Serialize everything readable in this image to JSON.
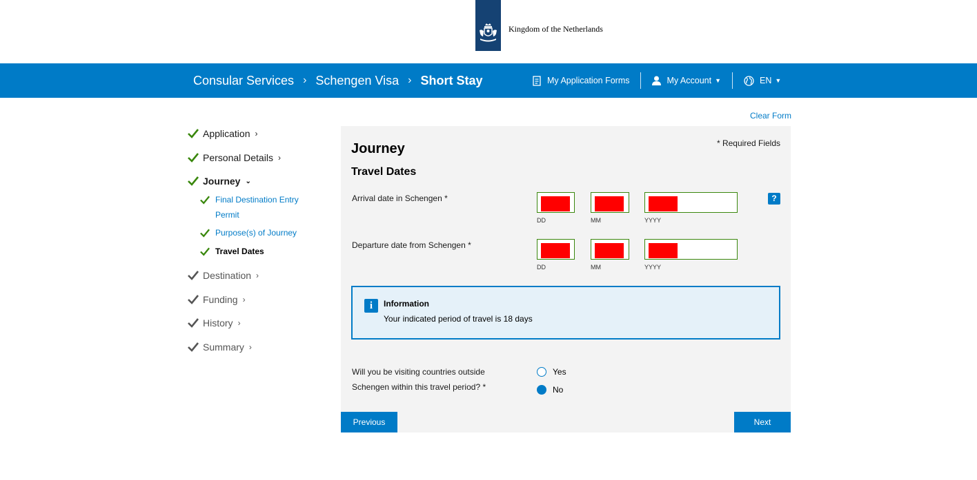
{
  "header": {
    "org_name": "Kingdom of the Netherlands"
  },
  "navbar": {
    "breadcrumbs": [
      "Consular Services",
      "Schengen Visa",
      "Short Stay"
    ],
    "application_forms": "My Application Forms",
    "account": "My Account",
    "language": "EN"
  },
  "clear_form": "Clear Form",
  "sidebar": {
    "steps": [
      {
        "label": "Application",
        "state": "done"
      },
      {
        "label": "Personal Details",
        "state": "done"
      },
      {
        "label": "Journey",
        "state": "active"
      },
      {
        "label": "Destination",
        "state": "todo"
      },
      {
        "label": "Funding",
        "state": "todo"
      },
      {
        "label": "History",
        "state": "todo"
      },
      {
        "label": "Summary",
        "state": "todo"
      }
    ],
    "journey_substeps": [
      {
        "label_line1": "Final Destination Entry",
        "label_line2": "Permit"
      },
      {
        "label_line1": "Purpose(s) of Journey"
      },
      {
        "label_line1": "Travel Dates"
      }
    ]
  },
  "form": {
    "title": "Journey",
    "subtitle": "Travel Dates",
    "required_note": "* Required Fields",
    "arrival_label": "Arrival date in Schengen *",
    "departure_label": "Departure date from Schengen *",
    "dd": "DD",
    "mm": "MM",
    "yyyy": "YYYY",
    "help": "?",
    "info": {
      "title": "Information",
      "text": "Your indicated period of travel is 18 days"
    },
    "question_line1": "Will you be visiting countries outside",
    "question_line2": "Schengen within this travel period? *",
    "options": {
      "yes": "Yes",
      "no": "No"
    },
    "selected": "No",
    "previous": "Previous",
    "next": "Next"
  },
  "colors": {
    "brand_blue": "#007bc7",
    "logo_navy": "#154273",
    "check_green": "#39870c",
    "redaction": "#ff0000"
  }
}
